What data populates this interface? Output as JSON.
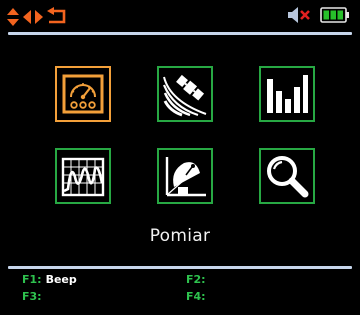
{
  "top_bar": {
    "nav_icons": [
      "up-down-arrows-icon",
      "left-right-arrows-icon",
      "return-icon"
    ],
    "status_icons": [
      "speaker-muted-icon",
      "battery-icon"
    ],
    "colors": {
      "nav": "#f3641f",
      "mute_cross": "#e02020",
      "battery": "#27c02a"
    }
  },
  "menu": {
    "items": [
      {
        "icon": "meter-gauge-icon",
        "selected": true
      },
      {
        "icon": "satellite-icon",
        "selected": false
      },
      {
        "icon": "bar-chart-icon",
        "selected": false
      },
      {
        "icon": "spectrum-analyzer-icon",
        "selected": false
      },
      {
        "icon": "satellite-dish-icon",
        "selected": false
      },
      {
        "icon": "magnifier-icon",
        "selected": false
      }
    ],
    "caption": "Pomiar",
    "colors": {
      "tile_border": "#27a843",
      "selected_border": "#f3a03a"
    }
  },
  "function_keys": [
    {
      "label": "F1:",
      "value": "Beep"
    },
    {
      "label": "F2:",
      "value": ""
    },
    {
      "label": "F3:",
      "value": ""
    },
    {
      "label": "F4:",
      "value": ""
    }
  ]
}
